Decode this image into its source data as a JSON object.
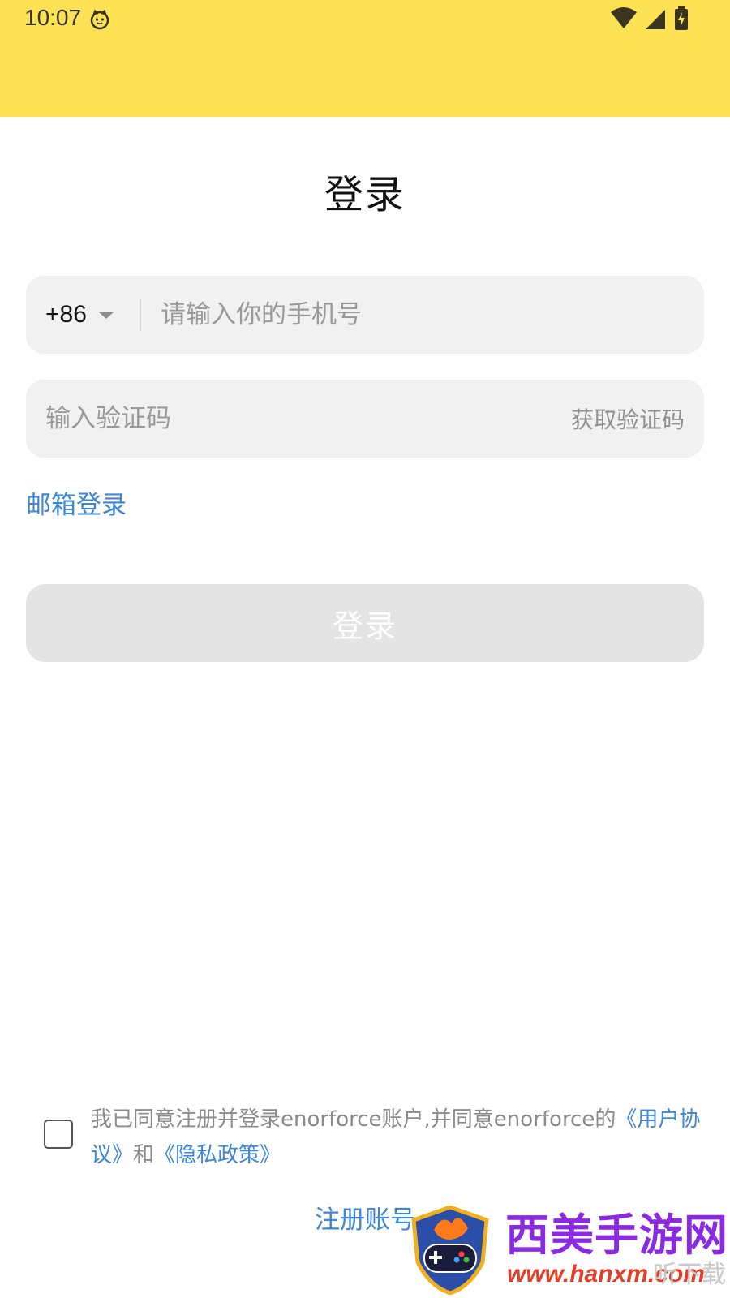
{
  "status_bar": {
    "time": "10:07",
    "background": "#fce254",
    "icons": [
      "cat-face-icon",
      "wifi-icon",
      "cellular-icon",
      "battery-charging-icon"
    ]
  },
  "page": {
    "title": "登录"
  },
  "phone_field": {
    "country_code": "+86",
    "placeholder": "请输入你的手机号",
    "value": ""
  },
  "code_field": {
    "placeholder": "输入验证码",
    "value": "",
    "get_code_label": "获取验证码"
  },
  "email_login_label": "邮箱登录",
  "login_button_label": "登录",
  "agreement": {
    "checked": false,
    "text_prefix": "我已同意注册并登录enorforce账户,并同意enorforce的",
    "user_agreement_link": "《用户协议》",
    "joiner": "和",
    "privacy_link": "《隐私政策》"
  },
  "register_label": "注册账号",
  "watermark": {
    "title": "西美手游网",
    "url": "www.hanxm.com",
    "faint_text": "听下载"
  },
  "colors": {
    "accent_link": "#3d86d6",
    "field_bg": "#f1f1f1",
    "button_disabled_bg": "#e4e4e4"
  }
}
